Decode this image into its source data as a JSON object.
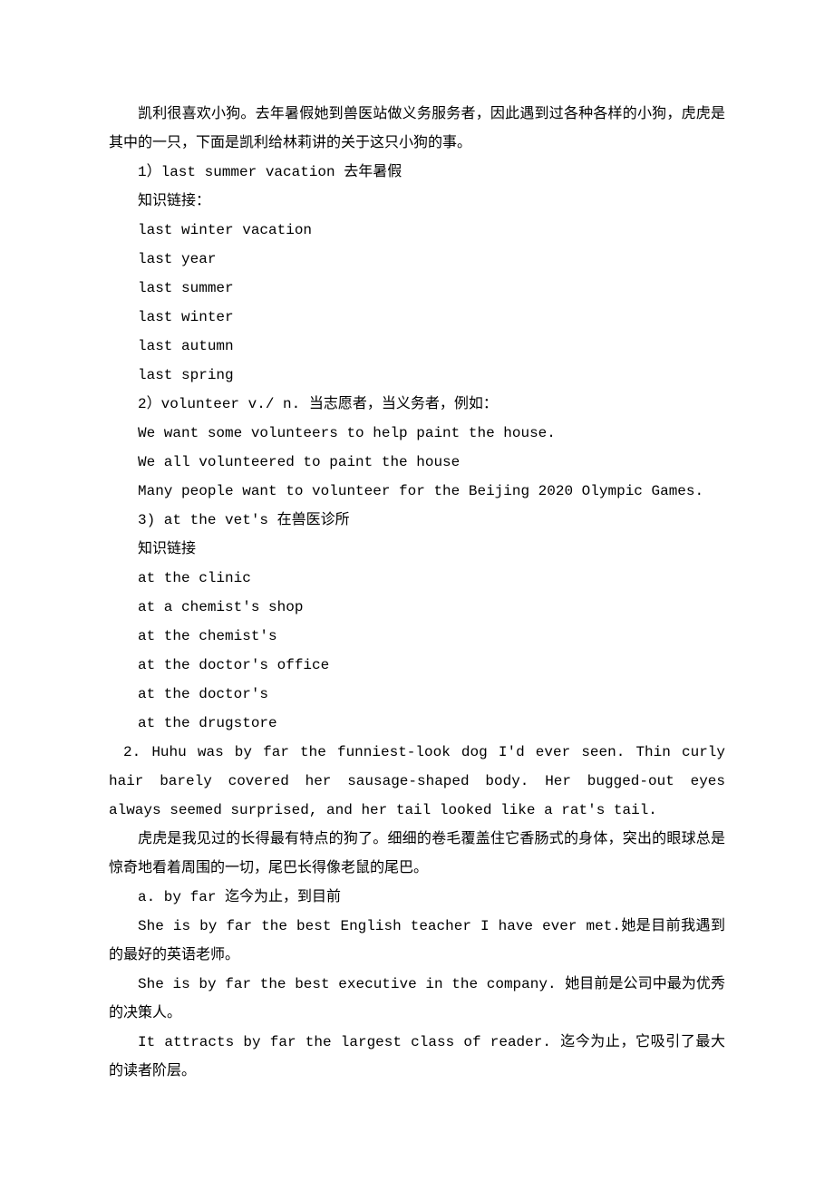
{
  "p1": "凯利很喜欢小狗。去年暑假她到兽医站做义务服务者，因此遇到过各种各样的小狗，虎虎是其中的一只，下面是凯利给林莉讲的关于这只小狗的事。",
  "item1_header": "1）last summer vacation   去年暑假",
  "link_label_1": "知识链接：",
  "link1_lines": [
    "last winter vacation",
    "last year",
    "last summer",
    "last winter",
    "last autumn",
    "last spring"
  ],
  "item2_header": "2）volunteer v./ n. 当志愿者，当义务者，例如：",
  "item2_lines": [
    "We want some volunteers to help paint the house.",
    "We all volunteered to paint the house",
    "Many people want to volunteer for the Beijing 2020 Olympic Games."
  ],
  "item3_header": "3) at the vet's   在兽医诊所",
  "link_label_2": "知识链接",
  "link3_lines": [
    "at the clinic",
    "at a chemist's shop",
    "at the chemist's",
    "at the doctor's office",
    "at the doctor's",
    "at the drugstore"
  ],
  "section2_en": "2. Huhu was by far the funniest-look dog I'd ever seen. Thin curly hair barely covered her sausage-shaped body. Her bugged-out eyes always seemed surprised, and her tail looked like a rat's tail.",
  "section2_zh": "虎虎是我见过的长得最有特点的狗了。细细的卷毛覆盖住它香肠式的身体，突出的眼球总是惊奇地看着周围的一切，尾巴长得像老鼠的尾巴。",
  "a_header": "a. by far  迄今为止，到目前",
  "a_ex1": "She is by far the best English teacher I have ever met.她是目前我遇到的最好的英语老师。",
  "a_ex2": "She is by far the best executive in the company.   她目前是公司中最为优秀的决策人。",
  "a_ex3": "It attracts by far the largest class of reader.       迄今为止，它吸引了最大的读者阶层。"
}
